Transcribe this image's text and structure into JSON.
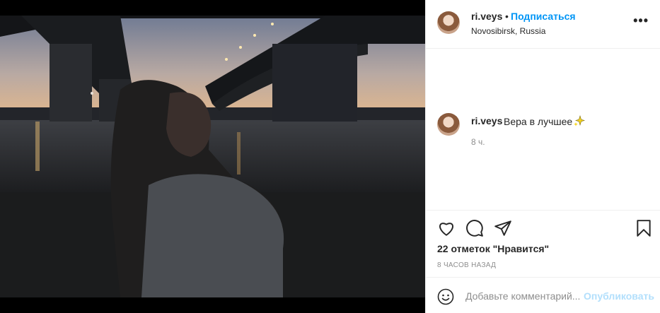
{
  "post": {
    "username": "ri.veys",
    "separator": "•",
    "follow_label": "Подписаться",
    "location": "Novosibirsk, Russia",
    "more_icon": "more-horizontal-icon"
  },
  "caption": {
    "username": "ri.veys",
    "text": "Вера в лучшее",
    "emoji": "sparkles",
    "time": "8 ч."
  },
  "actions": {
    "icons": [
      "heart-icon",
      "comment-icon",
      "share-icon",
      "bookmark-icon"
    ]
  },
  "likes_text": "22 отметок \"Нравится\"",
  "time_ago": "8 ЧАСОВ НАЗАД",
  "comment_box": {
    "placeholder": "Добавьте комментарий...",
    "publish_label": "Опубликовать"
  },
  "colors": {
    "link": "#0095f6",
    "publish_disabled": "#b2dffc",
    "muted": "#8e8e8e",
    "text": "#262626"
  }
}
